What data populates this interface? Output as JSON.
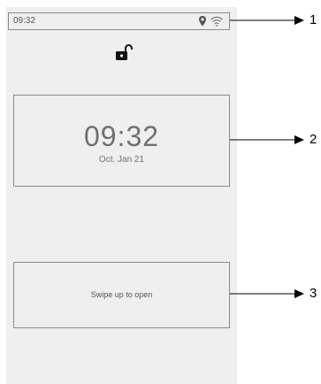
{
  "status_bar": {
    "time": "09:32",
    "icons": [
      "location-pin-icon",
      "wifi-icon"
    ]
  },
  "lock": {
    "icon": "unlocked-padlock-icon"
  },
  "clock": {
    "time": "09:32",
    "date": "Oct. Jan 21"
  },
  "swipe": {
    "text": "Swipe up to open"
  },
  "callouts": [
    {
      "label": "1"
    },
    {
      "label": "2"
    },
    {
      "label": "3"
    }
  ],
  "colors": {
    "screen_bg": "#efefef",
    "border": "#8a8a8a",
    "text": "#707070",
    "callout": "#000000"
  }
}
